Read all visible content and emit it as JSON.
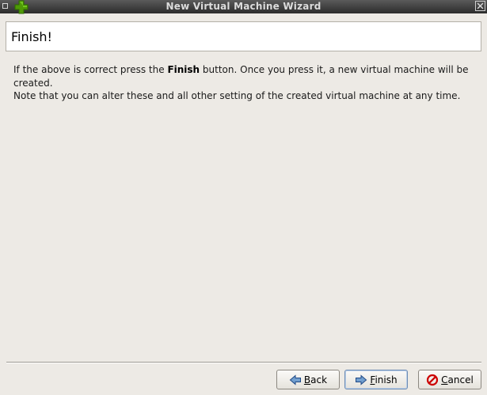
{
  "window": {
    "title": "New Virtual Machine Wizard",
    "menu_icon": "window-menu-icon",
    "app_icon": "green-plus-icon",
    "close_icon": "close-icon"
  },
  "header": {
    "title": "Finish!"
  },
  "description": {
    "line1_before": "If the above is correct press the ",
    "line1_bold": "Finish",
    "line1_after": " button. Once you press it, a new virtual machine will be created.",
    "line2": "Note that you can alter these and all other setting of the created virtual machine at any time."
  },
  "buttons": {
    "back": {
      "mnemonic": "B",
      "rest": "ack",
      "icon": "arrow-left-icon"
    },
    "finish": {
      "mnemonic": "F",
      "rest": "inish",
      "icon": "arrow-right-icon"
    },
    "cancel": {
      "mnemonic": "C",
      "rest": "ancel",
      "icon": "cancel-icon"
    }
  },
  "colors": {
    "window_bg": "#edeae5",
    "titlebar": "#3a3a3a",
    "arrow_blue": "#3465a4",
    "plus_green": "#4e9a06",
    "cancel_red": "#cc0000"
  }
}
